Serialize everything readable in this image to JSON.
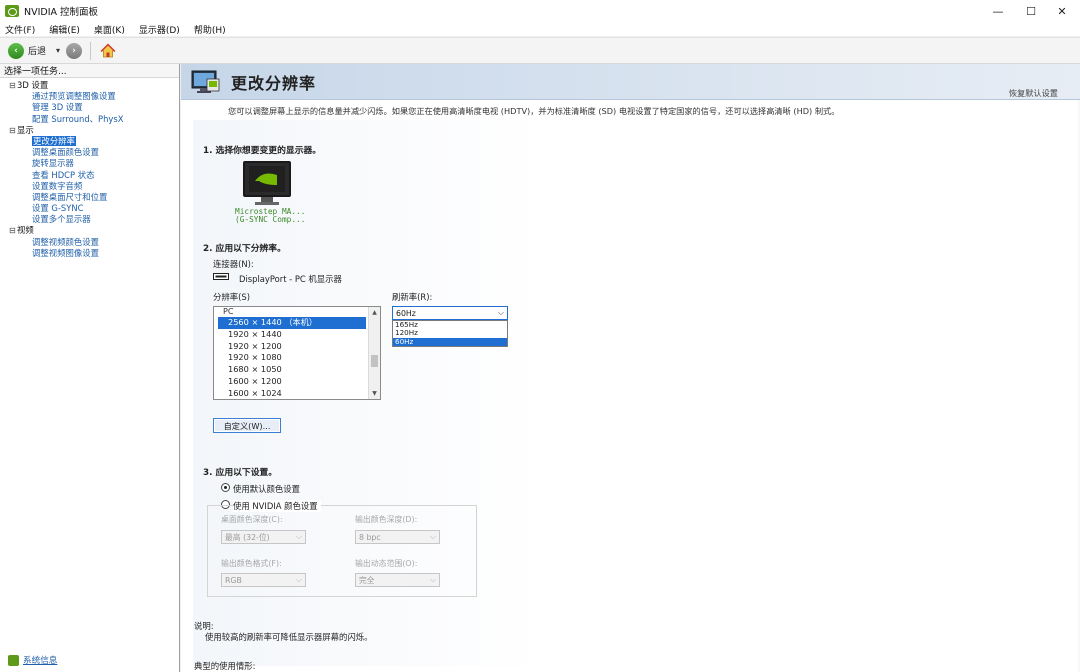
{
  "window": {
    "title": "NVIDIA 控制面板",
    "minimize": "—",
    "maximize": "☐",
    "close": "✕"
  },
  "menu": [
    "文件(F)",
    "编辑(E)",
    "桌面(K)",
    "显示器(D)",
    "帮助(H)"
  ],
  "toolbar": {
    "back_label": "后退",
    "dropdown_glyph": "▾",
    "forward_glyph": "›",
    "back_glyph": "‹"
  },
  "sidebar": {
    "header": "选择一项任务...",
    "tree": [
      {
        "type": "cat",
        "exp": "⊟",
        "label": "3D 设置"
      },
      {
        "type": "leaf",
        "label": "通过预览调整图像设置"
      },
      {
        "type": "leaf",
        "label": "管理 3D 设置"
      },
      {
        "type": "leaf",
        "label": "配置 Surround、PhysX"
      },
      {
        "type": "cat",
        "exp": "⊟",
        "label": "显示"
      },
      {
        "type": "leaf",
        "label": "更改分辨率",
        "selected": true
      },
      {
        "type": "leaf",
        "label": "调整桌面颜色设置"
      },
      {
        "type": "leaf",
        "label": "旋转显示器"
      },
      {
        "type": "leaf",
        "label": "查看 HDCP 状态"
      },
      {
        "type": "leaf",
        "label": "设置数字音频"
      },
      {
        "type": "leaf",
        "label": "调整桌面尺寸和位置"
      },
      {
        "type": "leaf",
        "label": "设置 G-SYNC"
      },
      {
        "type": "leaf",
        "label": "设置多个显示器"
      },
      {
        "type": "cat",
        "exp": "⊟",
        "label": "视频"
      },
      {
        "type": "leaf",
        "label": "调整视频颜色设置"
      },
      {
        "type": "leaf",
        "label": "调整视频图像设置"
      }
    ],
    "system_info": "系统信息"
  },
  "page": {
    "title": "更改分辨率",
    "restore_defaults": "恢复默认设置",
    "description": "您可以调整屏幕上显示的信息量并减少闪烁。如果您正在使用高清晰度电视 (HDTV)，并为标准清晰度 (SD) 电视设置了特定国家的信号，还可以选择高清晰 (HD) 制式。",
    "section1": "1.  选择你想要变更的显示器。",
    "monitor_name_line1": "Microstep MA...",
    "monitor_name_line2": "(G-SYNC Comp...",
    "section2": "2.  应用以下分辨率。",
    "connector_label": "连接器(N):",
    "connector_value": "DisplayPort - PC 机显示器",
    "resolution_label": "分辨率(S)",
    "resolution_group": "PC",
    "resolutions": [
      {
        "label": "2560 × 1440 （本机）",
        "selected": true
      },
      {
        "label": "1920 × 1440"
      },
      {
        "label": "1920 × 1200"
      },
      {
        "label": "1920 × 1080"
      },
      {
        "label": "1680 × 1050"
      },
      {
        "label": "1600 × 1200"
      },
      {
        "label": "1600 × 1024"
      }
    ],
    "refresh_label": "刷新率(R):",
    "refresh_selected": "60Hz",
    "refresh_options": [
      {
        "label": "165Hz"
      },
      {
        "label": "120Hz"
      },
      {
        "label": "60Hz",
        "selected": true
      }
    ],
    "custom_button": "自定义(W)...",
    "section3": "3.  应用以下设置。",
    "radio_default": "使用默认颜色设置",
    "radio_nvidia": "使用 NVIDIA 颜色设置",
    "desktop_depth_label": "桌面颜色深度(C):",
    "desktop_depth_value": "最高 (32-位)",
    "output_depth_label": "输出颜色深度(D):",
    "output_depth_value": "8 bpc",
    "output_format_label": "输出颜色格式(F):",
    "output_format_value": "RGB",
    "output_range_label": "输出动态范围(O):",
    "output_range_value": "完全",
    "explain_title": "说明:",
    "explain_text": "使用较高的刷新率可降低显示器屏幕的闪烁。",
    "typical_title": "典型的使用情形:"
  },
  "colors": {
    "accent": "#1e6fd1",
    "nvidia_green": "#76b900",
    "link": "#1f5fa8"
  }
}
